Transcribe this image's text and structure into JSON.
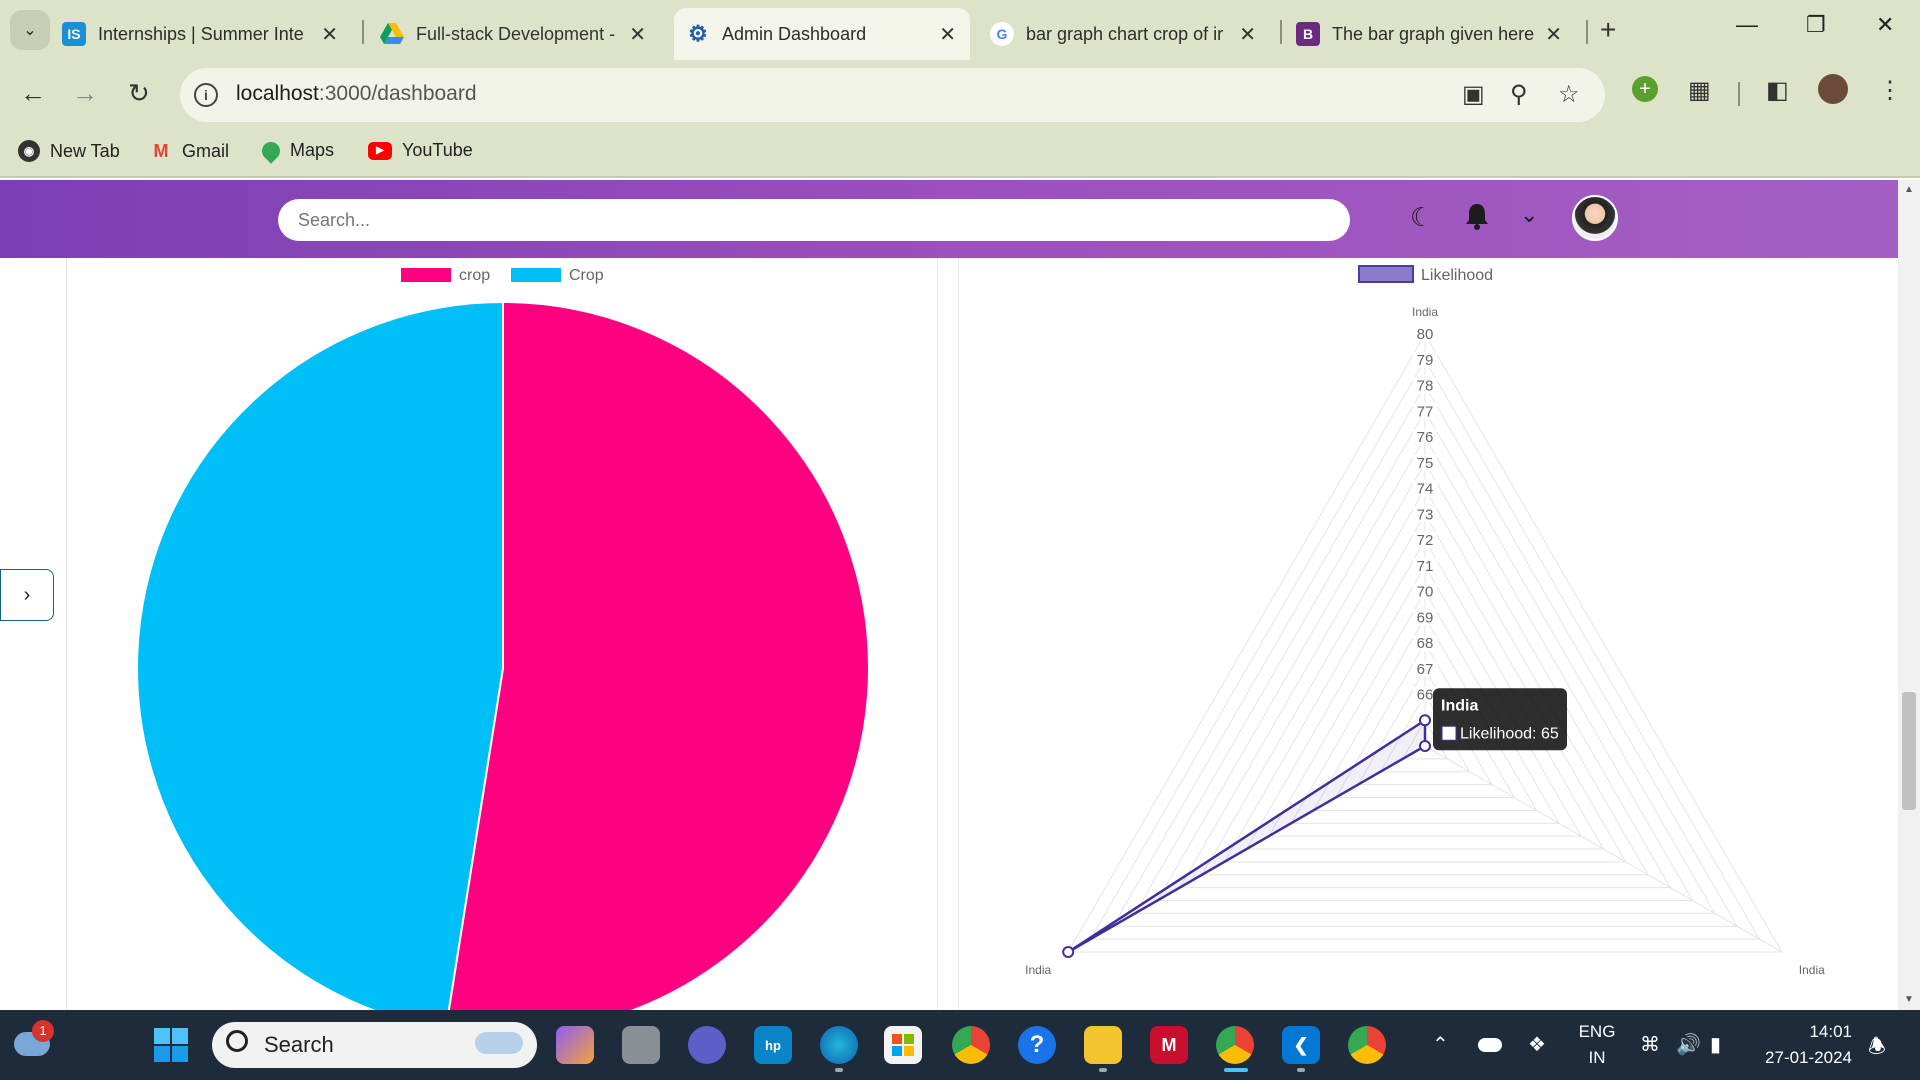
{
  "browser": {
    "tabs": [
      {
        "title": "Internships | Summer Inte",
        "favicon": "IS",
        "favicon_color": "#1a8fd6",
        "active": false
      },
      {
        "title": "Full-stack Development -",
        "favicon": "drive",
        "favicon_color": "#f4b400",
        "active": false
      },
      {
        "title": "Admin Dashboard",
        "favicon": "react",
        "favicon_color": "#1f5fa8",
        "active": true
      },
      {
        "title": "bar graph chart crop of ir",
        "favicon": "G",
        "favicon_color": "#4285f4",
        "active": false
      },
      {
        "title": "The bar graph given here",
        "favicon": "B",
        "favicon_color": "#6a2a7e",
        "active": false
      }
    ],
    "address": {
      "host": "localhost",
      "path": ":3000/dashboard"
    },
    "bookmarks": [
      {
        "label": "New Tab",
        "icon": "globe-icon",
        "color": "#333333"
      },
      {
        "label": "Gmail",
        "icon": "gmail-icon",
        "color": "#ea4335"
      },
      {
        "label": "Maps",
        "icon": "maps-pin-icon",
        "color": "#34a853"
      },
      {
        "label": "YouTube",
        "icon": "youtube-icon",
        "color": "#ff0000"
      }
    ]
  },
  "app": {
    "search": {
      "placeholder": "Search..."
    }
  },
  "charts": {
    "pie": {
      "legend": [
        {
          "label": "crop",
          "color": "#ff0080"
        },
        {
          "label": "Crop",
          "color": "#00bff7"
        }
      ]
    },
    "radar": {
      "legend": {
        "label": "Likelihood",
        "color": "#8a7cc8"
      },
      "tooltip": {
        "title": "India",
        "body": "Likelihood: 65"
      }
    }
  },
  "chart_data": [
    {
      "type": "pie",
      "labels": [
        "crop",
        "Crop"
      ],
      "values": [
        52.5,
        47.5
      ],
      "colors": [
        "#ff0080",
        "#00bff7"
      ]
    },
    {
      "type": "radar",
      "axes": [
        "India",
        "India",
        "India"
      ],
      "series": [
        {
          "name": "Likelihood",
          "values": [
            65,
            64,
            80
          ]
        }
      ],
      "r_ticks": [
        "66",
        "67",
        "68",
        "69",
        "70",
        "71",
        "72",
        "73",
        "74",
        "75",
        "76",
        "77",
        "78",
        "79",
        "80"
      ],
      "r_range": [
        64,
        80
      ],
      "grid": true
    }
  ],
  "taskbar": {
    "search_label": "Search",
    "weather_badge": "1",
    "lang_top": "ENG",
    "lang_bottom": "IN",
    "time": "14:01",
    "date": "27-01-2024"
  }
}
